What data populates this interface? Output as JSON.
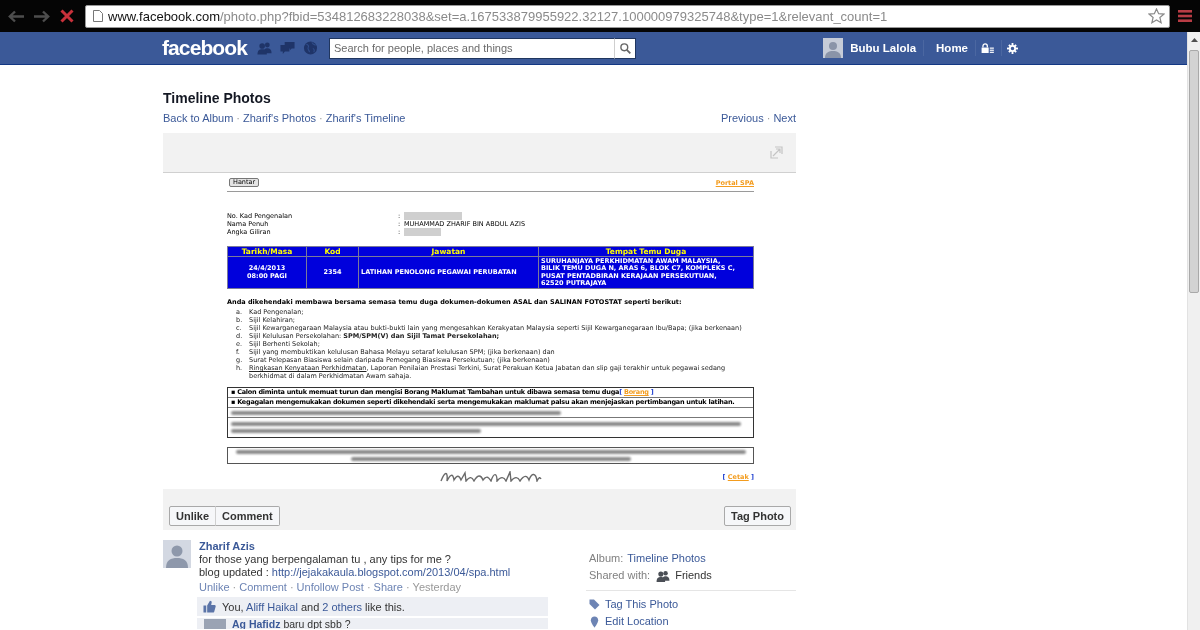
{
  "browser": {
    "url": {
      "host": "www.facebook.com",
      "path": "/photo.php?fbid=534812683228038&set=a.167533879955922.32127.100000979325748&type=1&relevant_count=1"
    }
  },
  "header": {
    "logo": "facebook",
    "search": {
      "placeholder": "Search for people, places and things"
    },
    "user": {
      "name": "Bubu Lalola"
    },
    "nav": [
      {
        "label": "Home"
      }
    ]
  },
  "page": {
    "title": "Timeline Photos",
    "breadcrumbs": [
      {
        "label": "Back to Album"
      },
      {
        "label": "Zharif's Photos",
        "sep": "·"
      },
      {
        "label": "Zharif's Timeline",
        "sep": "·"
      }
    ],
    "pager": [
      {
        "label": "Previous"
      },
      {
        "label": "Next",
        "sep": "·"
      }
    ]
  },
  "photo": {
    "document": {
      "button": "Hantar",
      "portal_link": "Portal SPA",
      "fields": [
        {
          "label": "No. Kad Pengenalan",
          "separator": ":",
          "kind": "redacted_long"
        },
        {
          "label": "Nama Penuh",
          "separator": ":",
          "kind": "text",
          "value": "MUHAMMAD ZHARIF BIN ABDUL AZIS"
        },
        {
          "label": "Angka Giliran",
          "separator": ":",
          "kind": "redacted_short"
        }
      ],
      "table": {
        "columns": [
          "Tarikh/Masa",
          "Kod",
          "Jawatan",
          "Tempat Temu Duga"
        ],
        "rows": [
          {
            "cells": [
              [
                "24/4/2013",
                "08:00 PAGI"
              ],
              [
                "2354"
              ],
              [
                "LATIHAN PENOLONG PEGAWAI PERUBATAN"
              ],
              [
                "SURUHANJAYA PERKHIDMATAN AWAM MALAYSIA,",
                "BILIK TEMU DUGA N, ARAS 6, BLOK C7, KOMPLEKS C,",
                "PUSAT PENTADBIRAN KERAJAAN PERSEKUTUAN,",
                "62520 PUTRAJAYA"
              ]
            ]
          }
        ]
      },
      "intro": "Anda dikehendaki membawa bersama semasa temu duga dokumen-dokumen ASAL dan SALINAN FOTOSTAT seperti berikut:",
      "items": [
        {
          "letter": "a.",
          "text": "Kad Pengenalan;"
        },
        {
          "letter": "b.",
          "text": "Sijil Kelahiran;"
        },
        {
          "letter": "c.",
          "text": "Sijil Kewarganegaraan Malaysia atau bukti-bukti lain yang mengesahkan Kerakyatan Malaysia seperti Sijil Kewarganegaraan Ibu/Bapa; (jika berkenaan)"
        },
        {
          "letter": "d.",
          "text": "Sijil Kelulusan Persekolahan: **SPM/SPM(V) dan Sijil Tamat Persekolahan;**"
        },
        {
          "letter": "e.",
          "text": "Sijil Berhenti Sekolah;"
        },
        {
          "letter": "f.",
          "text": "Sijil yang membuktikan kelulusan Bahasa Melayu setaraf kelulusan SPM; (jika berkenaan) dan"
        },
        {
          "letter": "g.",
          "text": "Surat Pelepasan Biasiswa selain daripada Pemegang Biasiswa Persekutuan; (jika berkenaan)"
        },
        {
          "letter": "h.",
          "link": "Ringkasan Kenyataan Perkhidmatan",
          "text": ", Laporan Penilaian Prestasi Terkini, Surat Perakuan Ketua Jabatan dan slip gaji terakhir untuk pegawai sedang berkhidmat di dalam Perkhidmatan Awam sahaja."
        }
      ],
      "notices": [
        {
          "kind": "text",
          "text": "▪ Calon diminta untuk memuat turun dan mengisi Borang Maklumat Tambahan untuk dibawa semasa temu duga",
          "link": {
            "before": "[ ",
            "label": "Borang",
            "after": " ]"
          }
        },
        {
          "kind": "text",
          "text": "▪ Kegagalan mengemukakan dokumen seperti dikehendaki serta mengemukakan maklumat palsu akan menjejaskan pertimbangan untuk latihan."
        },
        {
          "kind": "blurred"
        },
        {
          "kind": "blurred_tall"
        }
      ],
      "print_link": {
        "before": "[ ",
        "label": "Cetak",
        "after": " ]"
      }
    },
    "buttons": [
      {
        "label": "Unlike"
      },
      {
        "label": "Comment"
      }
    ],
    "tag_button": {
      "label": "Tag Photo"
    }
  },
  "post": {
    "author": "Zharif Azis",
    "lines": [
      {
        "text": "for those yang berpengalaman tu , any tips for me ?"
      },
      {
        "text": "blog updated : ",
        "link": "http://jejakakaula.blogspot.com/2013/04/spa.html"
      }
    ],
    "actions": [
      {
        "kind": "link",
        "label": "Unlike"
      },
      {
        "kind": "link",
        "label": "Comment",
        "sep": "·"
      },
      {
        "kind": "link",
        "label": "Unfollow Post",
        "sep": "·"
      },
      {
        "kind": "link",
        "label": "Share",
        "sep": "·"
      },
      {
        "kind": "time",
        "label": "Yesterday",
        "sep": "·"
      }
    ],
    "likes": [
      {
        "kind": "text",
        "text": "You, "
      },
      {
        "kind": "link",
        "text": "Aliff Haikal"
      },
      {
        "kind": "text",
        "text": " and "
      },
      {
        "kind": "link",
        "text": "2 others"
      },
      {
        "kind": "text",
        "text": " like this."
      }
    ],
    "comments": [
      {
        "author": "Ag Hafidz",
        "text": "baru dpt sbb ?"
      }
    ]
  },
  "sidebar": {
    "details": [
      {
        "kind": "link",
        "label": "Album:",
        "value": "Timeline Photos"
      },
      {
        "kind": "audience",
        "label": "Shared with:",
        "value": "Friends"
      }
    ],
    "options": [
      {
        "kind": "tag",
        "label": "Tag This Photo"
      },
      {
        "kind": "location",
        "label": "Edit Location"
      }
    ]
  }
}
